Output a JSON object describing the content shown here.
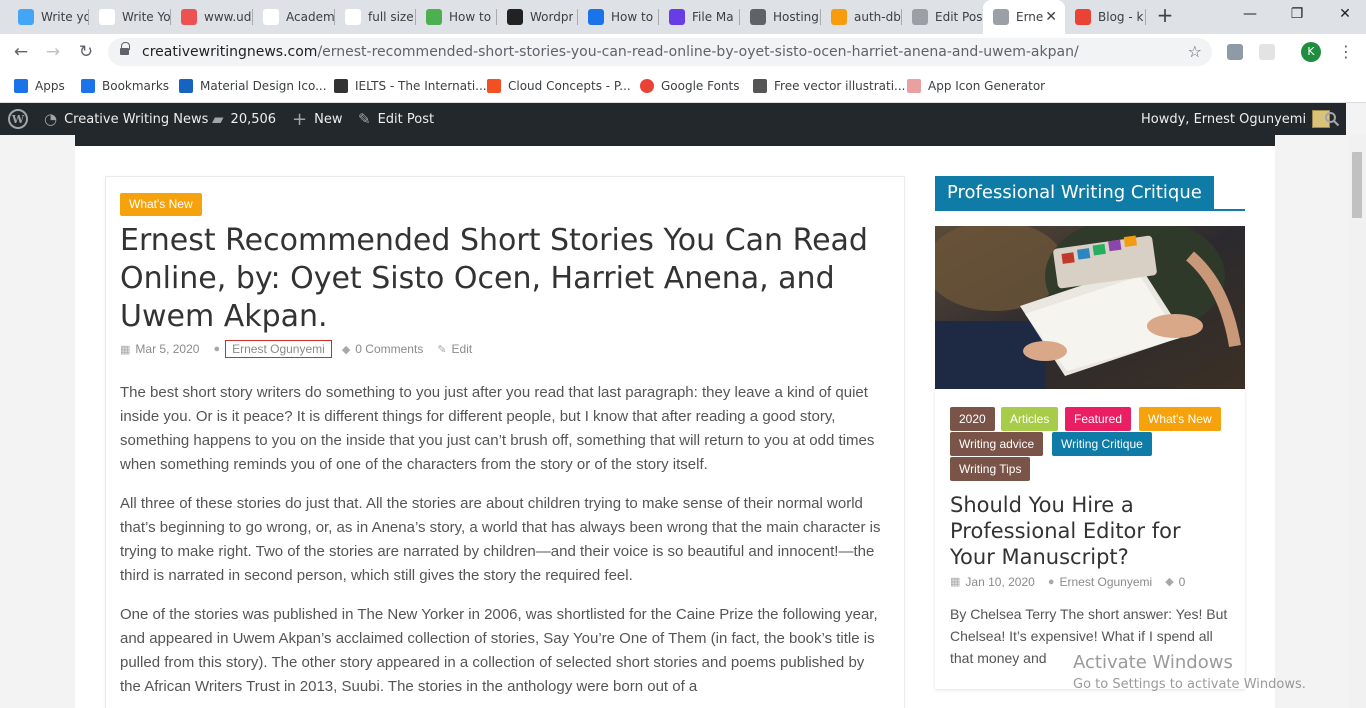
{
  "browser": {
    "tabs": [
      {
        "label": "Write yo",
        "icon": "flutter-icon",
        "color": "#42a5f5"
      },
      {
        "label": "Write Yo",
        "icon": "codepen-icon",
        "color": "#ffffff"
      },
      {
        "label": "www.ud",
        "icon": "udemy-icon",
        "color": "#ec5252"
      },
      {
        "label": "Academ",
        "icon": "academia-icon",
        "color": "#ffffff"
      },
      {
        "label": "full size",
        "icon": "google-icon",
        "color": "#ffffff"
      },
      {
        "label": "How to",
        "icon": "fx-icon",
        "color": "#4caf50"
      },
      {
        "label": "Wordpr",
        "icon": "wordpress-h-icon",
        "color": "#222222"
      },
      {
        "label": "How to",
        "icon": "medium-icon",
        "color": "#1a73e8"
      },
      {
        "label": "File Ma",
        "icon": "hostinger-icon",
        "color": "#673de6"
      },
      {
        "label": "Hosting",
        "icon": "globe-icon",
        "color": "#5f6368"
      },
      {
        "label": "auth-db",
        "icon": "phpmyadmin-icon",
        "color": "#f89c0e"
      },
      {
        "label": "Edit Pos",
        "icon": "loading-icon",
        "color": "#9aa0a6"
      },
      {
        "label": "Erne",
        "icon": "loading-icon",
        "color": "#9aa0a6",
        "active": true,
        "close": "✕"
      },
      {
        "label": "Blog - k",
        "icon": "gmail-icon",
        "color": "#ea4335"
      }
    ],
    "new_tab": "+",
    "window_controls": {
      "minimize": "—",
      "maximize": "❐",
      "close": "✕"
    },
    "nav": {
      "back": "←",
      "forward": "→",
      "reload": "↻"
    },
    "url_host": "creativewritingnews.com",
    "url_path": "/ernest-recommended-short-stories-you-can-read-online-by-oyet-sisto-ocen-harriet-anena-and-uwem-akpan/",
    "star": "☆",
    "profile_initial": "K",
    "menu": "⋮"
  },
  "bookmarks": [
    {
      "label": "Apps",
      "icon": "apps-grid-icon",
      "color": "#1a73e8"
    },
    {
      "label": "Bookmarks",
      "icon": "star-icon",
      "color": "#1a73e8"
    },
    {
      "label": "Material Design Ico...",
      "icon": "material-icon",
      "color": "#1565c0"
    },
    {
      "label": "IELTS - The Internati...",
      "icon": "ielts-icon",
      "color": "#333333"
    },
    {
      "label": "Cloud Concepts - P...",
      "icon": "microsoft-icon",
      "color": "#f25022"
    },
    {
      "label": "Google Fonts",
      "icon": "fonts-icon",
      "color": "#ea4335"
    },
    {
      "label": "Free vector illustrati...",
      "icon": "illustration-icon",
      "color": "#555555"
    },
    {
      "label": "App Icon Generator",
      "icon": "app-icon-generator-icon",
      "color": "#e8a0a0"
    }
  ],
  "adminbar": {
    "site_name": "Creative Writing News",
    "comments_count": "20,506",
    "new_label": "New",
    "edit_label": "Edit Post",
    "howdy": "Howdy, Ernest Ogunyemi",
    "wp_glyph": "W"
  },
  "post": {
    "category": "What's New",
    "title": "Ernest Recommended Short Stories You Can Read Online, by: Oyet Sisto Ocen, Harriet Anena, and Uwem Akpan.",
    "date": "Mar 5, 2020",
    "author": "Ernest Ogunyemi",
    "comments": "0 Comments",
    "edit": "Edit",
    "paragraphs": [
      "The best short story writers do something to you just after you read that last paragraph: they leave a kind of quiet inside you. Or is it peace? It is different things for different people, but I know that after reading a good story, something happens to you on the inside that you just can’t brush off, something that will return to you at odd times when something reminds you of one of the characters from the story or of the story itself.",
      "All three of these stories do just that. All the stories are about children trying to make sense of their normal world that’s beginning to go wrong, or, as in Anena’s story, a world that has always been wrong that the main character is trying to make right. Two of the stories are narrated by children—and their voice is so beautiful and innocent!—the third is narrated in second person, which still gives the story the required feel.",
      "One of the stories was published in The New Yorker in 2006, was shortlisted for the Caine Prize the following year, and appeared in Uwem Akpan’s acclaimed collection of stories, Say You’re One of Them (in fact, the book’s title is pulled from this story). The other story appeared in a collection of selected short stories and poems published by the African Writers Trust in 2013, Suubi. The stories in the anthology were born out of a"
    ]
  },
  "sidebar": {
    "widget_title": "Professional Writing Critique",
    "tags": [
      {
        "label": "2020",
        "color": "#7a5448"
      },
      {
        "label": "Articles",
        "color": "#a7cc4a"
      },
      {
        "label": "Featured",
        "color": "#e91e63"
      },
      {
        "label": "What's New",
        "color": "#f5a20d"
      },
      {
        "label": "Writing advice",
        "color": "#7a5448"
      },
      {
        "label": "Writing Critique",
        "color": "#0e7ca6"
      },
      {
        "label": "Writing Tips",
        "color": "#7a5448"
      }
    ],
    "post_title": "Should You Hire a Professional Editor for Your Manuscript?",
    "date": "Jan 10, 2020",
    "author": "Ernest Ogunyemi",
    "comments": "0",
    "excerpt": "By Chelsea Terry   The short answer:  Yes! But Chelsea! It’s expensive! What if I spend all that money and"
  },
  "os_overlay": {
    "line1": "Activate Windows",
    "line2": "Go to Settings to activate Windows."
  }
}
